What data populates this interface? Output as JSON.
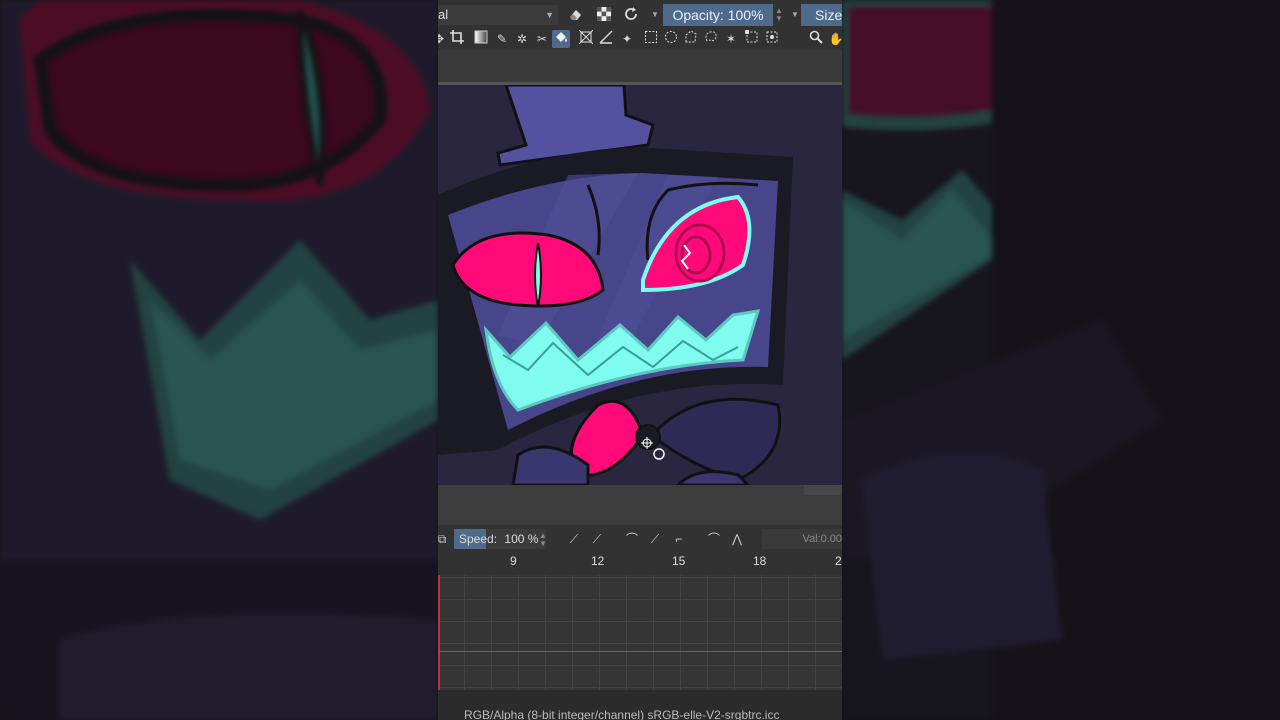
{
  "toolbar": {
    "blend_mode_value": "al",
    "opacity_label": "Opacity: 100%",
    "size_label": "Size:"
  },
  "animation": {
    "speed_label": "Speed:",
    "speed_value": "100 %",
    "speed_fraction": 0.35,
    "value_label": "Val:0.00"
  },
  "ruler": {
    "ticks": [
      "9",
      "12",
      "15",
      "18",
      "2"
    ]
  },
  "status": {
    "text": "RGB/Alpha (8-bit integer/channel)  sRGB-elle-V2-srgbtrc.icc"
  },
  "colors": {
    "accent": "#4e6b8b",
    "eye_pink": "#ff0a78",
    "teeth_cyan": "#7ffcef",
    "screen_purple": "#4a4a8c"
  },
  "icons": {
    "toolbar": [
      "eraser-icon",
      "alpha-lock-icon",
      "reload-icon",
      "dropdown-icon"
    ],
    "tools": [
      "move-icon",
      "crop-icon",
      "gradient-icon",
      "eyedropper-icon",
      "smart-patch-icon",
      "colorize-mask-icon",
      "fill-icon",
      "transform-icon",
      "measure-icon",
      "assistant-icon",
      "rect-select-icon",
      "ellipse-select-icon",
      "polygon-select-icon",
      "freehand-select-icon",
      "magic-wand-icon",
      "bezier-select-icon",
      "similar-select-icon",
      "zoom-icon",
      "pan-icon"
    ]
  }
}
